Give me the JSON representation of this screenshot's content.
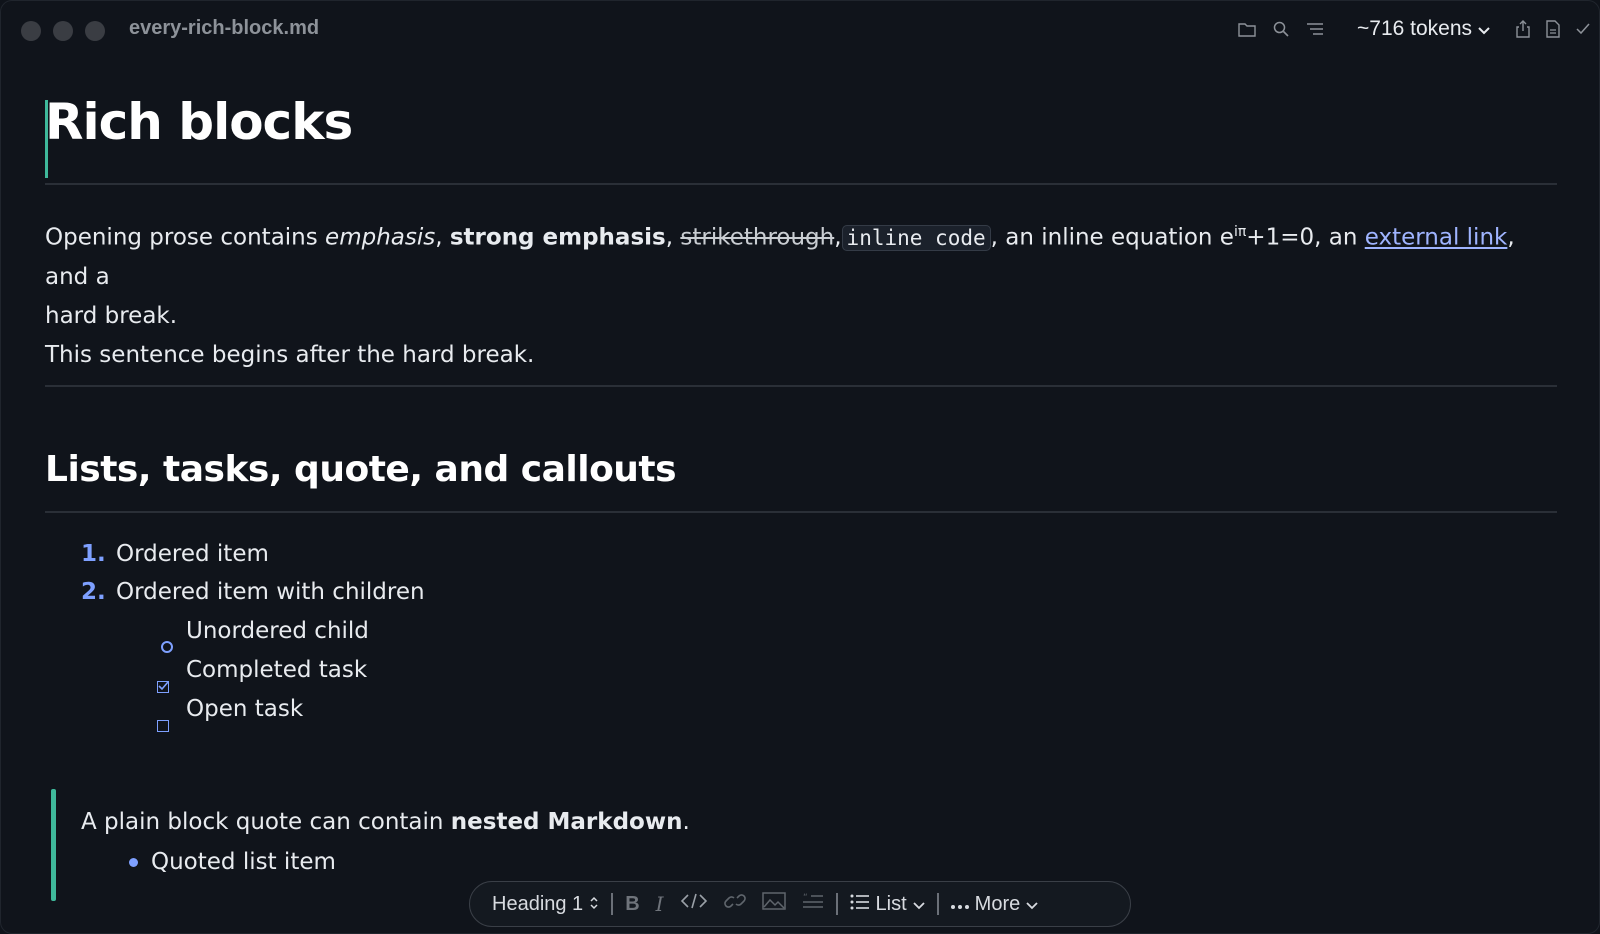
{
  "window": {
    "filename": "every-rich-block.md",
    "tokens_label": "~716 tokens"
  },
  "document": {
    "title": "Rich blocks",
    "paragraph": {
      "t1": "Opening prose contains ",
      "emphasis": "emphasis",
      "t2": ", ",
      "strong": "strong emphasis",
      "t3": ", ",
      "strike": "strikethrough",
      "t4": ",",
      "code": "inline code",
      "t5": ", an inline equation e",
      "sup": "iπ",
      "t6": "+1=0, an ",
      "link": "external link",
      "t7": ", and a",
      "t8": "hard break.",
      "line2": "This sentence begins after the hard break."
    },
    "section_heading": "Lists, tasks, quote, and callouts",
    "list": {
      "item1_num": "1.",
      "item1": "Ordered item",
      "item2_num": "2.",
      "item2": "Ordered item with children",
      "child1": "Unordered child",
      "task_done": "Completed task",
      "task_open": "Open task"
    },
    "quote": {
      "text_start": "A plain block quote can contain ",
      "text_strong": "nested Markdown",
      "text_end": ".",
      "item": "Quoted list item"
    }
  },
  "toolbar": {
    "block_type": "Heading 1",
    "list_label": "List",
    "more_label": "More"
  },
  "colors": {
    "accent": "#7ea0ff",
    "quote_bar": "#3fb99b",
    "link": "#9fb4ff",
    "background": "#10141b"
  }
}
